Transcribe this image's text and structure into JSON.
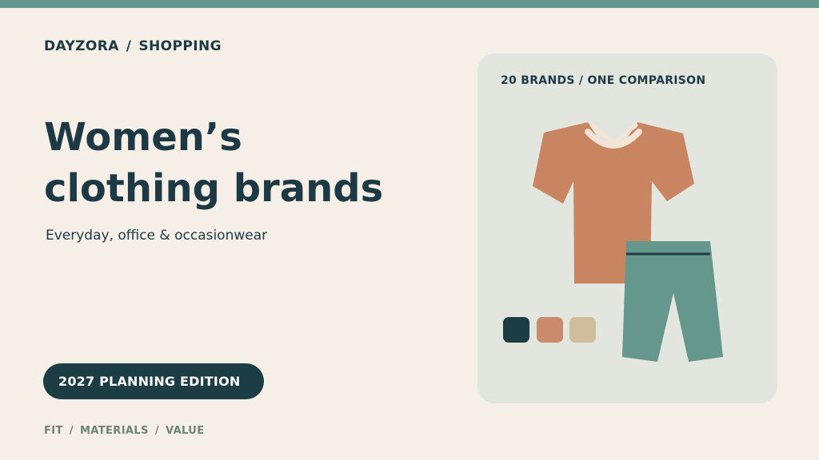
{
  "breadcrumb": {
    "brand": "DAYZORA",
    "separator": "/",
    "section": "SHOPPING"
  },
  "hero": {
    "title_line1": "Women’s",
    "title_line2": "clothing brands",
    "subtitle": "Everyday, office & occasionwear"
  },
  "edition": {
    "label": "2027 PLANNING EDITION"
  },
  "footer": {
    "tags": [
      "FIT",
      "MATERIALS",
      "VALUE"
    ],
    "separator": "/"
  },
  "card": {
    "label": "20 BRANDS / ONE COMPARISON",
    "illustration_icons": [
      "tshirt-icon",
      "pants-icon"
    ],
    "swatches": [
      "#1c3d44",
      "#c98b6b",
      "#cfbd9c"
    ]
  },
  "colors": {
    "background": "#f5efe8",
    "accent_bar": "#66978d",
    "text_dark": "#1d3a44",
    "card_bg": "#e2e6df",
    "tshirt": "#c98462",
    "pants": "#66978d",
    "muted_text": "#6e8377"
  }
}
